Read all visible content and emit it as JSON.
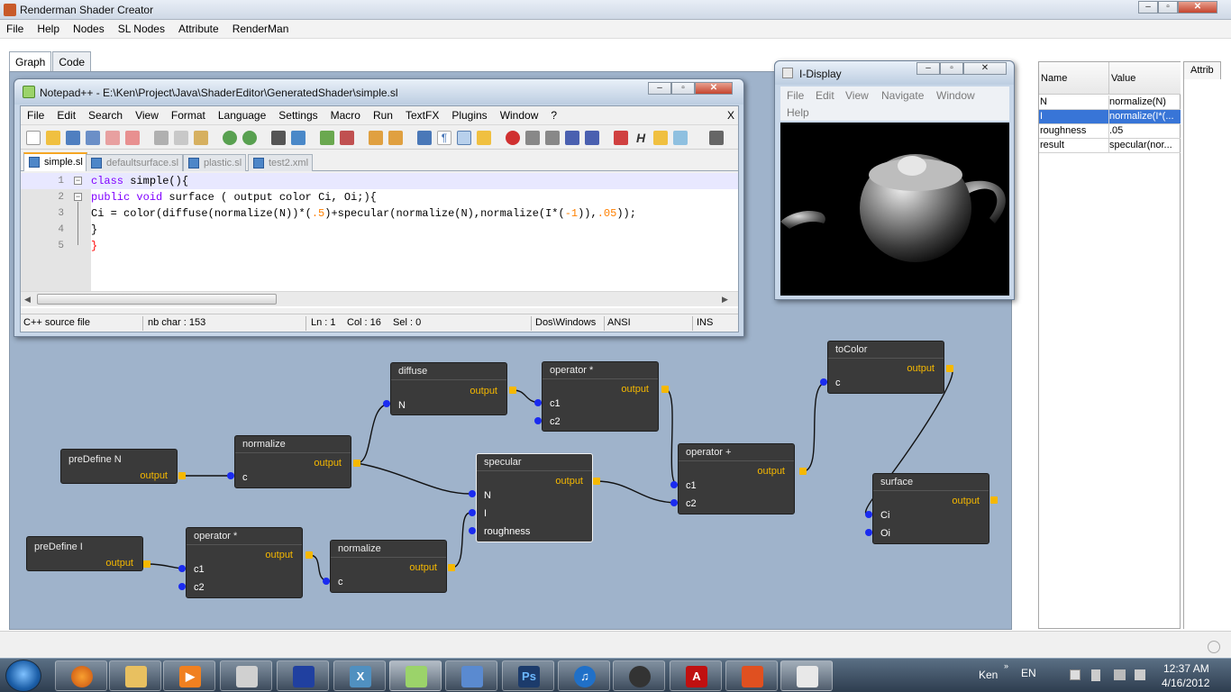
{
  "app": {
    "title": "Renderman Shader Creator",
    "menu": [
      "File",
      "Help",
      "Nodes",
      "SL Nodes",
      "Attribute",
      "RenderMan"
    ],
    "tabs": [
      "Graph",
      "Code"
    ]
  },
  "notepad": {
    "title": "Notepad++ - E:\\Ken\\Project\\Java\\ShaderEditor\\GeneratedShader\\simple.sl",
    "menu": [
      "File",
      "Edit",
      "Search",
      "View",
      "Format",
      "Language",
      "Settings",
      "Macro",
      "Run",
      "TextFX",
      "Plugins",
      "Window",
      "?"
    ],
    "close_x": "X",
    "tabs": [
      "simple.sl",
      "defaultsurface.sl",
      "plastic.sl",
      "test2.xml"
    ],
    "line_numbers": [
      "1",
      "2",
      "3",
      "4",
      "5"
    ],
    "code": {
      "l1_kw": "class",
      "l1_rest": " simple(){",
      "l2_kw1": "public",
      "l2_kw2": " void",
      "l2_rest": " surface ( output color Ci, Oi;){",
      "l3_a": "Ci = color(diffuse(normalize(N))*(",
      "l3_num1": ".5",
      "l3_b": ")+specular(normalize(N),normalize(I*(",
      "l3_num2": "-1",
      "l3_c": ")),",
      "l3_num3": ".05",
      "l3_d": "));",
      "l4": "}",
      "l5": "}"
    },
    "status": {
      "type": "C++ source file",
      "chars": "nb char : 153",
      "ln": "Ln : 1",
      "col": "Col : 16",
      "sel": "Sel : 0",
      "eol": "Dos\\Windows",
      "enc": "ANSI",
      "mode": "INS"
    }
  },
  "idisplay": {
    "title": "I-Display",
    "menu_row1": [
      "File",
      "Edit",
      "View",
      "Navigate",
      "Window"
    ],
    "menu_row2": [
      "Help"
    ]
  },
  "attributes": {
    "col_name": "Name",
    "col_value": "Value",
    "tab": "Attrib",
    "rows": [
      {
        "name": "N",
        "value": "normalize(N)"
      },
      {
        "name": "I",
        "value": "normalize(I*(..."
      },
      {
        "name": "roughness",
        "value": ".05"
      },
      {
        "name": "result",
        "value": "specular(nor..."
      }
    ]
  },
  "nodes": {
    "diffuse": {
      "title": "diffuse",
      "out": "output",
      "in1": "N"
    },
    "op_mul1": {
      "title": "operator *",
      "out": "output",
      "in1": "c1",
      "in2": "c2"
    },
    "tocolor": {
      "title": "toColor",
      "out": "output",
      "in1": "c"
    },
    "predefN": {
      "title": "preDefine  N",
      "out": "output"
    },
    "normalize1": {
      "title": "normalize",
      "out": "output",
      "in1": "c"
    },
    "specular": {
      "title": "specular",
      "out": "output",
      "in1": "N",
      "in2": "I",
      "in3": "roughness"
    },
    "op_add": {
      "title": "operator +",
      "out": "output",
      "in1": "c1",
      "in2": "c2"
    },
    "surface": {
      "title": "surface",
      "out": "output",
      "in1": "Ci",
      "in2": "Oi"
    },
    "predefI": {
      "title": "preDefine  I",
      "out": "output"
    },
    "op_mul2": {
      "title": "operator *",
      "out": "output",
      "in1": "c1",
      "in2": "c2"
    },
    "normalize2": {
      "title": "normalize",
      "out": "output",
      "in1": "c"
    }
  },
  "taskbar": {
    "user": "Ken",
    "lang": "EN",
    "time": "12:37 AM",
    "date": "4/16/2012"
  },
  "colors": {
    "canvas": "#9fb3cb",
    "node": "#3a3a3a",
    "port_in": "#1a2bf0",
    "port_out": "#f5b800",
    "selection": "#3875d7"
  }
}
